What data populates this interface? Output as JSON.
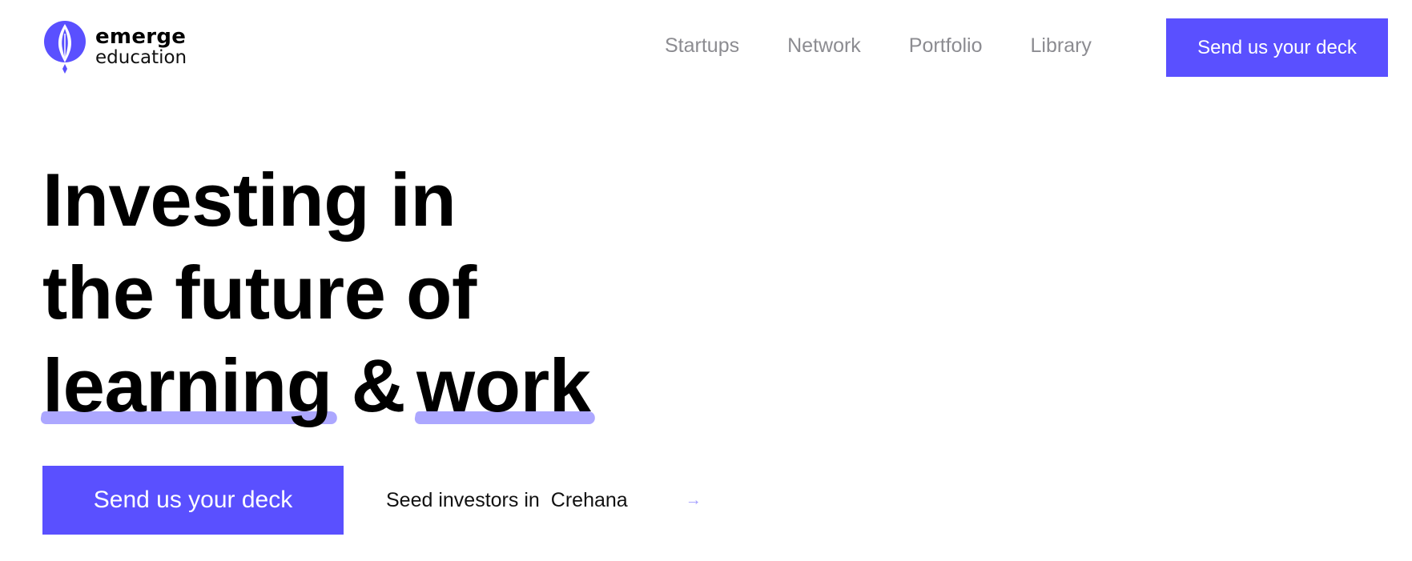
{
  "brand": {
    "name_line1": "emerge",
    "name_line2": "education",
    "accent_color": "#5a50ff",
    "highlight_color": "#a39dff",
    "logo_icon": "flame-pen-nib-icon"
  },
  "nav": {
    "items": [
      {
        "label": "Startups"
      },
      {
        "label": "Network"
      },
      {
        "label": "Portfolio"
      },
      {
        "label": "Library"
      }
    ],
    "cta_label": "Send us your deck"
  },
  "hero": {
    "headline_line1": "Investing in",
    "headline_line2": "the future of",
    "headline_word_learning": "learning",
    "headline_amp": "&",
    "headline_word_work": "work",
    "cta_label": "Send us your deck",
    "seed_prefix": "Seed investors in",
    "seed_company": "Crehana",
    "seed_arrow": "→"
  }
}
